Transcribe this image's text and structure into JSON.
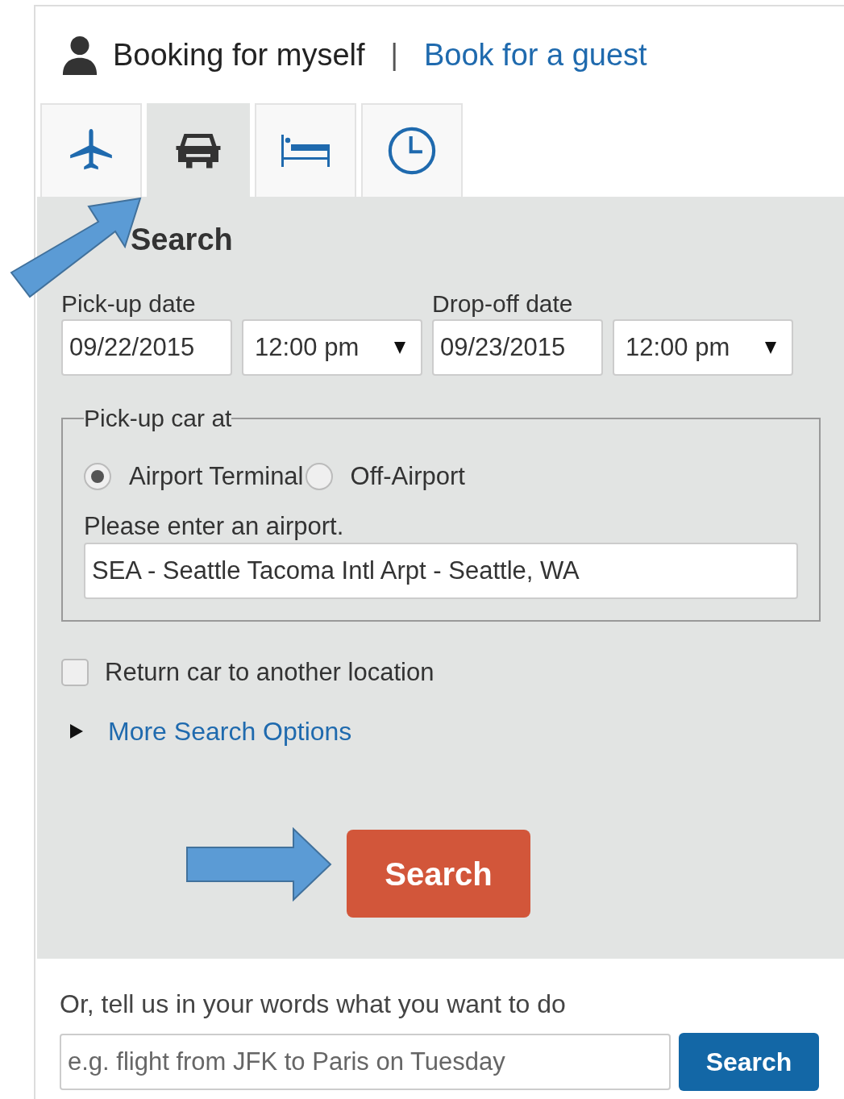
{
  "booking": {
    "self_label": "Booking for myself",
    "separator": "|",
    "guest_link": "Book for a guest"
  },
  "tabs": [
    {
      "kind": "flight",
      "selected": false
    },
    {
      "kind": "car",
      "selected": true
    },
    {
      "kind": "hotel",
      "selected": false
    },
    {
      "kind": "time",
      "selected": false
    }
  ],
  "heading": "Search",
  "dates": [
    {
      "label": "Pick-up date",
      "date": "09/22/2015",
      "time": "12:00 pm"
    },
    {
      "label": "Drop-off date",
      "date": "09/23/2015",
      "time": "12:00 pm"
    }
  ],
  "location": {
    "legend": "Pick-up car at",
    "options": [
      {
        "label": "Airport Terminal",
        "selected": true
      },
      {
        "label": "Off-Airport",
        "selected": false
      }
    ],
    "prompt": "Please enter an airport.",
    "value": "SEA - Seattle Tacoma Intl Arpt - Seattle, WA"
  },
  "return_other": {
    "label": "Return car to another location",
    "checked": false
  },
  "more_options": {
    "label": "More Search Options",
    "expanded": false
  },
  "search_button": "Search",
  "freeform": {
    "prompt": "Or, tell us in your words what you want to do",
    "placeholder": "e.g. flight from JFK to Paris on Tuesday",
    "button": "Search"
  }
}
